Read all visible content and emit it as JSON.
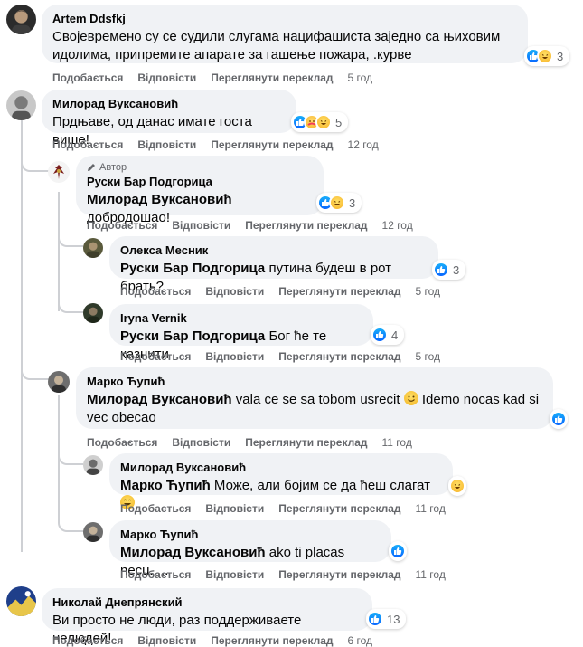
{
  "labels": {
    "like": "Подобається",
    "reply": "Відповісти",
    "translate": "Переглянути переклад",
    "author_badge": "Автор"
  },
  "colors": {
    "bubble": "#f0f2f5",
    "secondary_text": "#65676b",
    "like_blue": "#0866ff",
    "thread_line": "#ced0d4"
  },
  "comments": [
    {
      "author": "Artem Ddsfkj",
      "text": "Својевремено су се судили слугама нацифашиста заједно са њиховим идолима, припремите апарате за гашење пожара, .курве",
      "time": "5 год",
      "reactions": [
        "like",
        "haha"
      ],
      "reaction_count": "3"
    },
    {
      "author": "Милорад Вуксановић",
      "text": "Прдњаве, од данас имате госта више!",
      "time": "12 год",
      "reactions": [
        "like",
        "care",
        "haha"
      ],
      "reaction_count": "5"
    },
    {
      "author": "Руски Бар Подгорица",
      "mention": "Милорад Вуксановић",
      "text": "добродошао!",
      "time": "12 год",
      "reactions": [
        "like",
        "haha"
      ],
      "reaction_count": "3"
    },
    {
      "author": "Олекса Месник",
      "mention": "Руски Бар Подгорица",
      "text": "путина будеш в рот брать?",
      "time": "5 год",
      "reactions": [
        "like"
      ],
      "reaction_count": "3"
    },
    {
      "author": "Iryna Vernik",
      "mention": "Руски Бар Подгорица",
      "text": "Бог ће те казнити",
      "time": "5 год",
      "reactions": [
        "like"
      ],
      "reaction_count": "4"
    },
    {
      "author": "Марко Ћупић",
      "mention": "Милорад Вуксановић",
      "text": "vala ce se sa tobom usrecit",
      "text2": "Idemo nocas kad si vec obecao",
      "time": "11 год",
      "reactions": [
        "like"
      ],
      "reaction_count": ""
    },
    {
      "author": "Милорад Вуксановић",
      "mention": "Марко Ћупић",
      "text": "Може, али бојим се да ћеш слагат",
      "time": "11 год",
      "reactions": [
        "haha"
      ],
      "reaction_count": ""
    },
    {
      "author": "Марко Ћупић",
      "mention": "Милорад Вуксановић",
      "text": "ako ti placas necu.....",
      "time": "11 год",
      "reactions": [
        "like"
      ],
      "reaction_count": ""
    },
    {
      "author": "Николай Днепрянский",
      "text": "Ви просто не люди, раз поддерживаете нелюдей!",
      "time": "6 год",
      "reactions": [
        "like"
      ],
      "reaction_count": "13"
    }
  ]
}
